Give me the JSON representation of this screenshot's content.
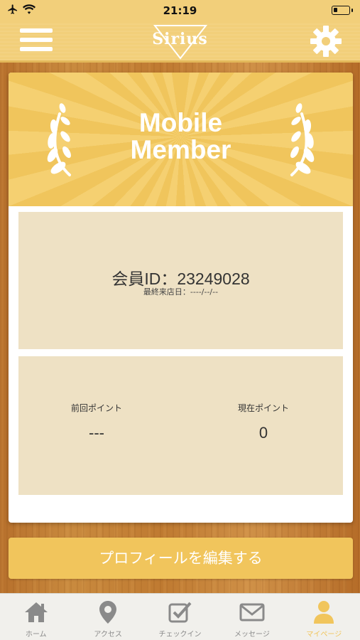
{
  "status_bar": {
    "time": "21:19"
  },
  "header": {
    "logo_text": "Sirius"
  },
  "card": {
    "banner_title_line1": "Mobile",
    "banner_title_line2": "Member",
    "member_id_label": "会員ID：",
    "member_id": "23249028",
    "last_visit_label": "最終来店日：",
    "last_visit": "----/--/--",
    "prev_points_label": "前回ポイント",
    "prev_points": "---",
    "current_points_label": "現在ポイント",
    "current_points": "0"
  },
  "edit_button_label": "プロフィールを編集する",
  "tabs": [
    {
      "label": "ホーム",
      "icon": "home-icon"
    },
    {
      "label": "アクセス",
      "icon": "map-pin-icon"
    },
    {
      "label": "チェックイン",
      "icon": "checkbox-icon"
    },
    {
      "label": "メッセージ",
      "icon": "envelope-icon"
    },
    {
      "label": "マイページ",
      "icon": "person-icon",
      "active": true
    }
  ],
  "colors": {
    "accent": "#f1c55c",
    "panel": "#eee1c4",
    "tab_inactive": "#8a8a8a"
  }
}
